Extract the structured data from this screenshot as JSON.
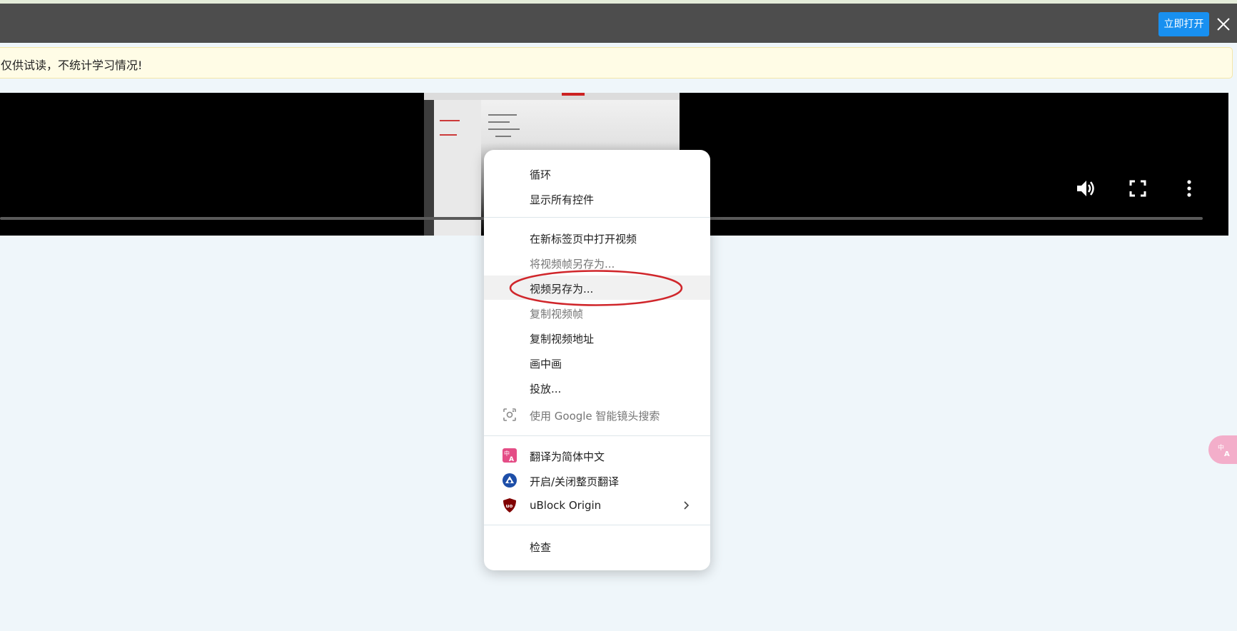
{
  "topbar": {
    "open_button": "立即打开"
  },
  "notice": {
    "text": "仅供试读，不统计学习情况!"
  },
  "player": {
    "controls": [
      "volume-icon",
      "fullscreen-icon",
      "more-vert-icon"
    ]
  },
  "context_menu": {
    "groups": [
      {
        "items": [
          {
            "label": "循环",
            "disabled": false
          },
          {
            "label": "显示所有控件",
            "disabled": false
          }
        ]
      },
      {
        "items": [
          {
            "label": "在新标签页中打开视频",
            "disabled": false
          },
          {
            "label": "将视频帧另存为...",
            "disabled": true
          },
          {
            "label": "视频另存为...",
            "disabled": false,
            "highlighted": true
          },
          {
            "label": "复制视频帧",
            "disabled": true
          },
          {
            "label": "复制视频地址",
            "disabled": false
          },
          {
            "label": "画中画",
            "disabled": false
          },
          {
            "label": "投放...",
            "disabled": false
          },
          {
            "label": "使用 Google 智能镜头搜索",
            "disabled": true,
            "icon": "lens-icon"
          }
        ]
      },
      {
        "items": [
          {
            "label": "翻译为简体中文",
            "icon": "translate-icon"
          },
          {
            "label": "开启/关闭整页翻译",
            "icon": "immersive-translate-icon"
          },
          {
            "label": "uBlock Origin",
            "icon": "ublock-icon",
            "submenu": true
          }
        ]
      },
      {
        "items": [
          {
            "label": "检查",
            "disabled": false
          }
        ]
      }
    ]
  },
  "annotation": {
    "color": "#d0262b",
    "target": "视频另存为..."
  },
  "colors": {
    "accent": "#1890f0",
    "topbar": "#4d4d4d",
    "notice_bg": "#fffce6"
  }
}
